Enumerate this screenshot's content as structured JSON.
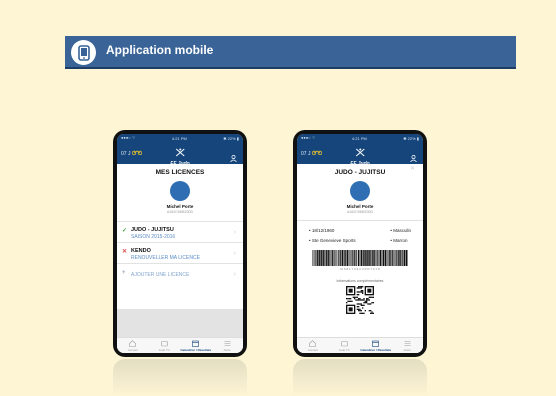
{
  "banner": {
    "title": "Application mobile",
    "icon": "mobile-phone-icon"
  },
  "status_bar": {
    "carrier": "●●●○ ⌔",
    "time": "4:21 PM",
    "battery": "✱ 22% ▮"
  },
  "app_bar": {
    "left_text": "07 J",
    "logo_text": "FF Judo"
  },
  "licences_screen": {
    "title": "MES LICENCES",
    "person_name": "Michel Porte",
    "person_id": "A162C9M5Z00D",
    "items": [
      {
        "name": "JUDO - JUJITSU",
        "sub": "SAISON 2015-2016",
        "mark": "✓",
        "mark_color": "#3aa03a"
      },
      {
        "name": "KENDO",
        "sub": "RENOUVELLER MA LICENCE",
        "mark": "✕",
        "mark_color": "#e04a4a"
      }
    ],
    "add_label": "AJOUTER UNE LICENCE"
  },
  "card_screen": {
    "title": "JUDO - JUJITSU",
    "person_name": "Michel Porte",
    "person_id": "A162C9M5Z00D",
    "left_info": [
      "• 18/12/1960",
      "• Ste Genevieve Sports"
    ],
    "right_info": [
      "• Masculin",
      "• Marron"
    ],
    "barcode_number": "M S 8 1 7 0 6 C 0 P R T 0 1 8",
    "qr_label": "Informations complémentaires"
  },
  "tabs": [
    {
      "label": "Accueil"
    },
    {
      "label": "Judo TV"
    },
    {
      "label": "Calendrier / Résultats"
    },
    {
      "label": "Autre"
    }
  ]
}
